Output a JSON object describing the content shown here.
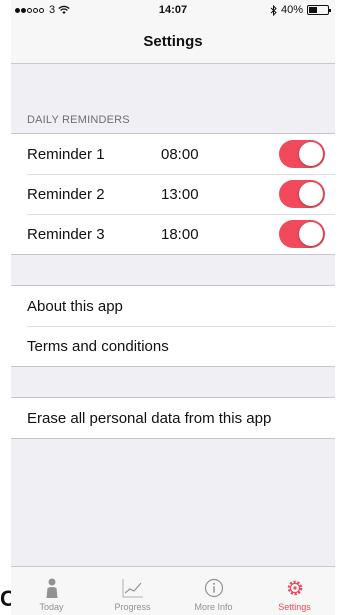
{
  "status_bar": {
    "carrier": "3",
    "time": "14:07",
    "battery": "40%"
  },
  "nav": {
    "title": "Settings"
  },
  "reminders": {
    "header": "DAILY REMINDERS",
    "items": [
      {
        "label": "Reminder 1",
        "time": "08:00",
        "enabled": true
      },
      {
        "label": "Reminder 2",
        "time": "13:00",
        "enabled": true
      },
      {
        "label": "Reminder 3",
        "time": "18:00",
        "enabled": true
      }
    ]
  },
  "info": {
    "about": "About this app",
    "terms": "Terms and conditions"
  },
  "data": {
    "erase": "Erase all personal data from this app"
  },
  "tabs": [
    {
      "label": "Today",
      "icon": "person-icon"
    },
    {
      "label": "Progress",
      "icon": "chart-icon"
    },
    {
      "label": "More Info",
      "icon": "info-icon"
    },
    {
      "label": "Settings",
      "icon": "gear-icon",
      "active": true
    }
  ],
  "colors": {
    "accent": "#f24a5b",
    "background": "#efeff4",
    "inactive": "#929292"
  },
  "stray_glyph": "C."
}
